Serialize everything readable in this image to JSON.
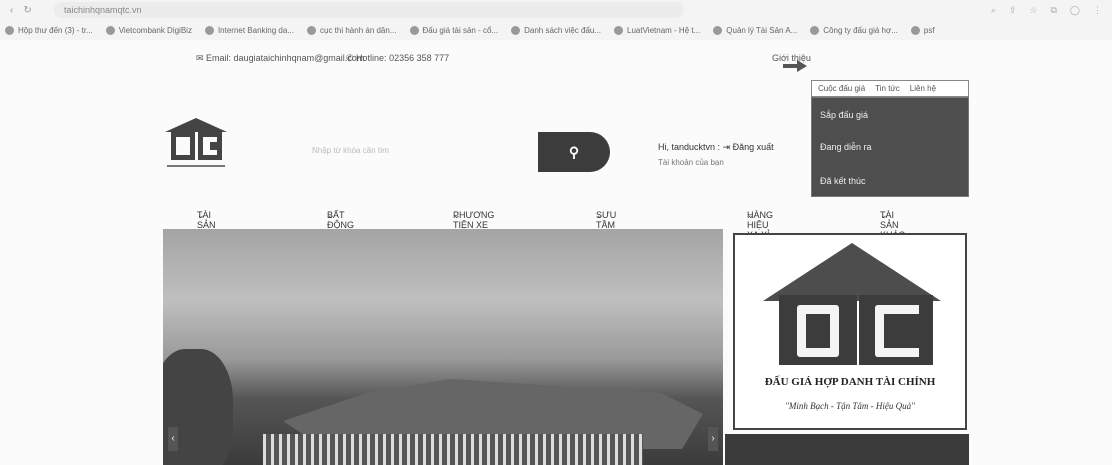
{
  "browser": {
    "url": "taichinhqnamqtc.vn",
    "bookmarks": [
      "Hộp thư đến (3) - tr...",
      "Vietcombank DigiBiz",
      "Internet Banking da...",
      "cục thi hành án dân...",
      "Đấu giá tài sản - cổ...",
      "Danh sách việc đấu...",
      "LuatVietnam - Hệ t...",
      "Quản lý Tài Sản A...",
      "Công ty đấu giá hợ...",
      "psf"
    ]
  },
  "topbar": {
    "email": "Email: daugiataichinhqnam@gmail.com",
    "hotline": "Hotline: 02356 358 777",
    "intro": "Giới thiệu"
  },
  "dropdown": {
    "tabs": [
      "Cuộc đấu giá",
      "Tin tức",
      "Liên hệ"
    ],
    "items": [
      "Sắp đấu giá",
      "Đang diễn ra",
      "Đã kết thúc"
    ]
  },
  "search": {
    "placeholder": "Nhập từ khóa cần tìm"
  },
  "user": {
    "greeting": "Hi, tanducktvn :",
    "logout": "Đăng xuất",
    "account": "Tài khoản của bạn"
  },
  "nav": {
    "items": [
      "TÀI SẢN THANH LÝ",
      "BẤT ĐỘNG SẢN",
      "PHƯƠNG TIỆN XE CỘ",
      "SƯU TẦM NGHỆ THUẬT",
      "HÀNG HIỆU XA XỈ",
      "TÀI SẢN KHÁC"
    ]
  },
  "ad": {
    "title": "ĐẤU GIÁ HỢP DANH TÀI CHÍNH",
    "slogan": "\"Minh Bạch - Tận Tâm - Hiệu Quả\""
  }
}
